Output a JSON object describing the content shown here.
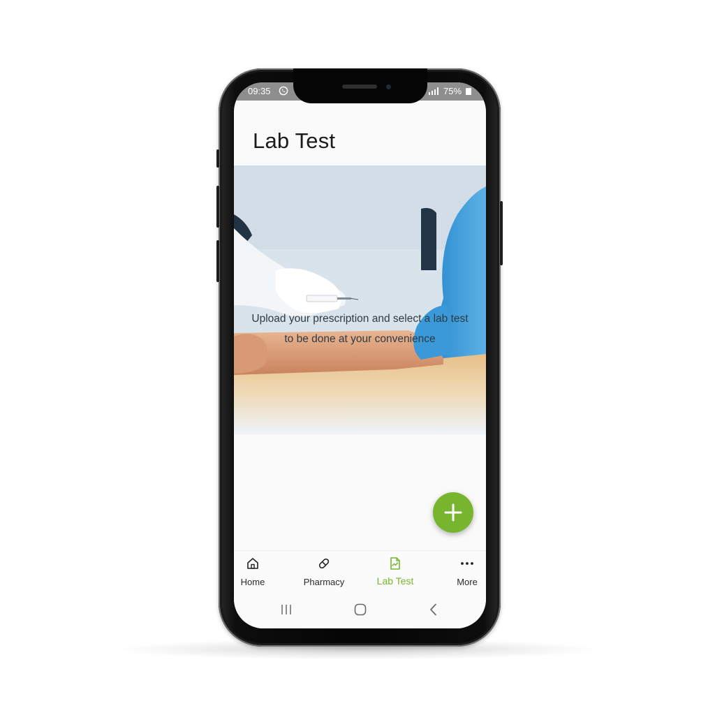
{
  "status_bar": {
    "time": "09:35",
    "battery": "75%"
  },
  "page": {
    "title": "Lab Test"
  },
  "hero": {
    "line1": "Upload your prescription and select a lab test",
    "line2": "to be done at your convenience"
  },
  "fab": {
    "icon": "plus-icon"
  },
  "bottom_nav": {
    "items": [
      {
        "label": "Home",
        "icon": "home-icon"
      },
      {
        "label": "Pharmacy",
        "icon": "pill-icon"
      },
      {
        "label": "Lab Test",
        "icon": "lab-report-icon",
        "active": true
      },
      {
        "label": "More",
        "icon": "more-dots-icon"
      }
    ]
  },
  "colors": {
    "accent": "#77b52f",
    "status_bar": "#8e8e8e",
    "title_text": "#1b1b1b"
  }
}
